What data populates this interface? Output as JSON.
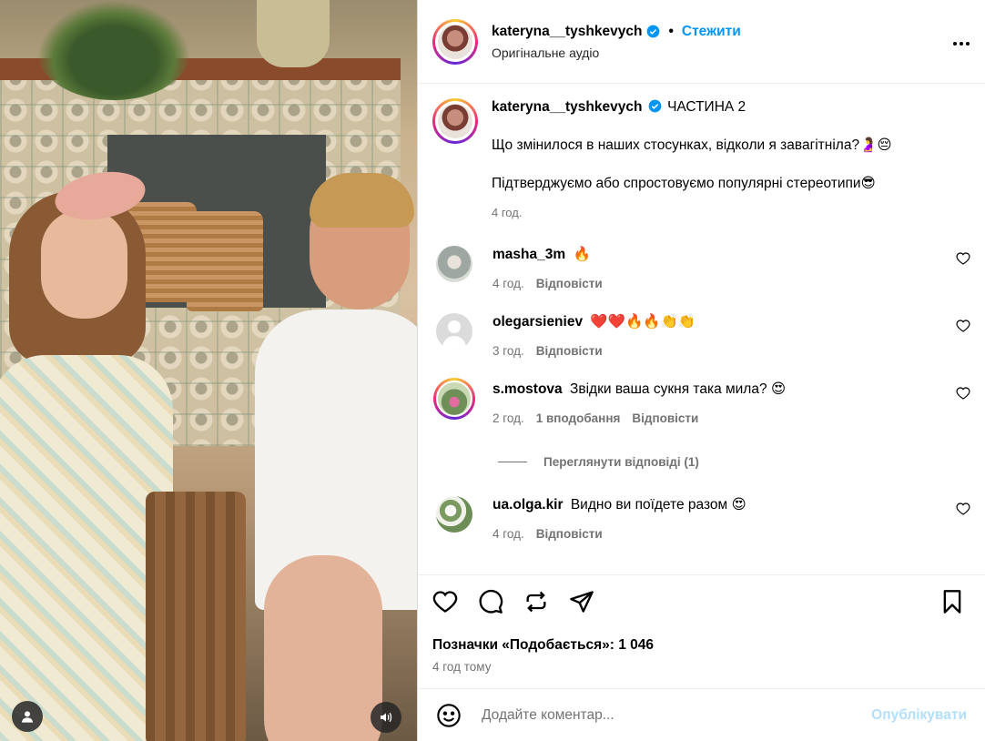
{
  "post": {
    "username": "kateryna__tyshkevych",
    "follow_label": "Стежити",
    "dot": "•",
    "audio": "Оригінальне аудіо"
  },
  "caption": {
    "username": "kateryna__tyshkevych",
    "title": "ЧАСТИНА 2",
    "line1": "Що змінилося в наших стосунках, відколи я завагітніла?🤰😔",
    "line2": "Підтверджуємо або спростовуємо популярні стереотипи😎",
    "time": "4 год."
  },
  "comments": [
    {
      "username": "masha_3m",
      "text": "🔥",
      "time": "4 год.",
      "likes": "",
      "reply": "Відповісти"
    },
    {
      "username": "olegarsieniev",
      "text": "❤️❤️🔥🔥👏👏",
      "time": "3 год.",
      "likes": "",
      "reply": "Відповісти"
    },
    {
      "username": "s.mostova",
      "text": "Звідки ваша сукня така мила? 😍",
      "time": "2 год.",
      "likes": "1 вподобання",
      "reply": "Відповісти"
    },
    {
      "username": "ua.olga.kir",
      "text": "Видно ви поїдете разом 😍",
      "time": "4 год.",
      "likes": "",
      "reply": "Відповісти"
    }
  ],
  "view_replies": "Переглянути відповіді (1)",
  "likes_text": "Позначки «Подобається»: 1 046",
  "posted_time": "4 год тому",
  "compose": {
    "placeholder": "Додайте коментар...",
    "publish": "Опублікувати"
  },
  "colors": {
    "accent": "#0095f6",
    "publish_disabled": "#b2dffc",
    "muted": "#737373"
  },
  "icons": [
    "like-icon",
    "comment-icon",
    "share-icon",
    "send-icon",
    "save-icon",
    "emoji-icon",
    "tag-icon",
    "sound-icon",
    "more-icon",
    "verified-icon"
  ]
}
